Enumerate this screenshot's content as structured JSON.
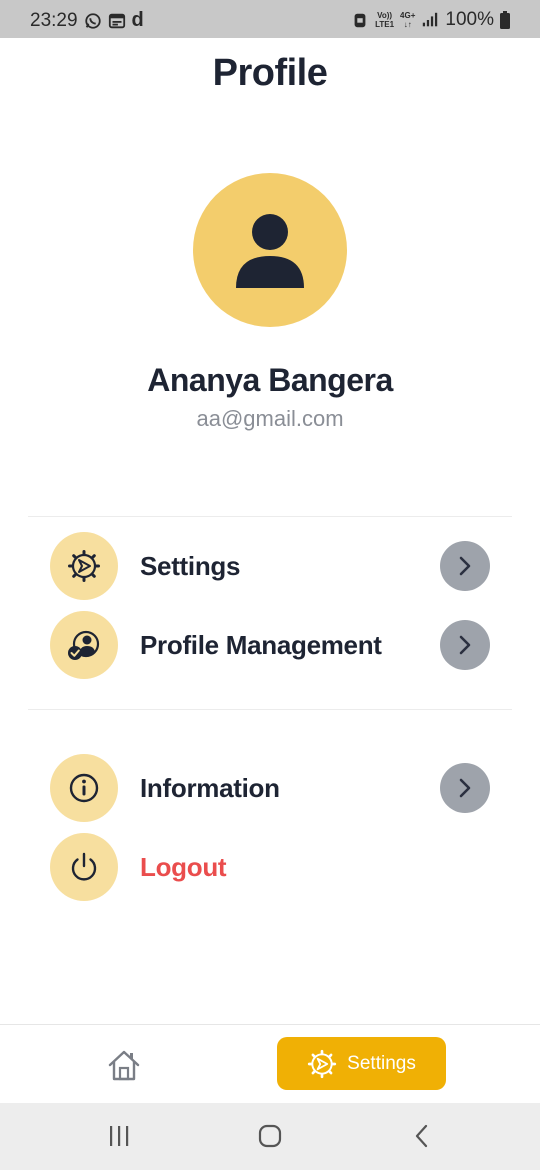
{
  "status_bar": {
    "time": "23:29",
    "net_top": "Vo))",
    "net_bottom": "LTE1",
    "gen_top": "4G+",
    "gen_bottom": "↓↑",
    "battery": "100%",
    "icons": [
      "whatsapp-icon",
      "calendar-icon",
      "d-app-icon",
      "lock-icon",
      "signal-icon",
      "battery-icon"
    ]
  },
  "header": {
    "title": "Profile"
  },
  "profile": {
    "avatar_icon": "user-icon",
    "name": "Ananya Bangera",
    "email": "aa@gmail.com"
  },
  "menu": {
    "group1": [
      {
        "label": "Settings",
        "icon": "gear-icon",
        "has_chevron": true
      },
      {
        "label": "Profile Management",
        "icon": "user-check-icon",
        "has_chevron": true
      }
    ],
    "group2": [
      {
        "label": "Information",
        "icon": "info-icon",
        "has_chevron": true
      },
      {
        "label": "Logout",
        "icon": "power-icon",
        "has_chevron": false
      }
    ]
  },
  "bottom_nav": {
    "home_icon": "home-icon",
    "settings_label": "Settings",
    "settings_icon": "gear-icon",
    "active": "Settings"
  },
  "colors": {
    "accent": "#f0b005",
    "avatar_bg": "#f3cd6c",
    "icon_bg": "#f7df9f",
    "text_dark": "#1e2433",
    "logout_red": "#ea4d4d",
    "chevron_bg": "#9ea3ab"
  }
}
